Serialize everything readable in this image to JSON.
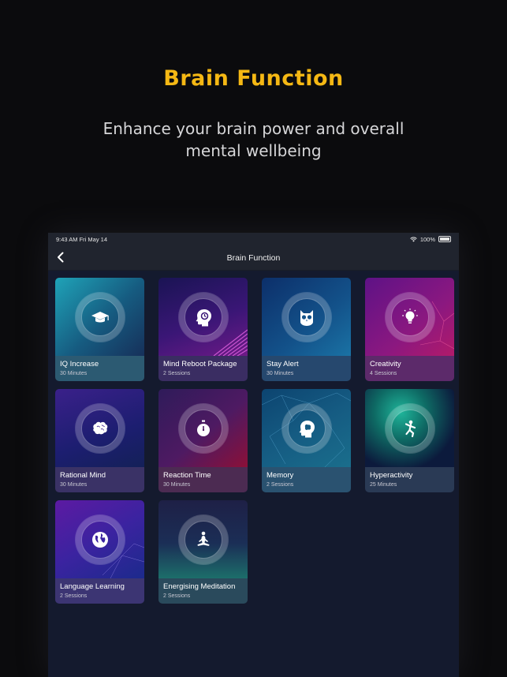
{
  "hero": {
    "title": "Brain Function",
    "subtitle": "Enhance your brain power and overall mental wellbeing"
  },
  "statusbar": {
    "time_date": "9:43 AM   Fri May 14",
    "battery": "100%"
  },
  "nav": {
    "title": "Brain Function",
    "back_icon": "chevron-left-icon"
  },
  "cards": [
    {
      "title": "IQ Increase",
      "subtitle": "30 Minutes",
      "icon": "graduation-cap-icon"
    },
    {
      "title": "Mind Reboot Package",
      "subtitle": "2 Sessions",
      "icon": "head-reboot-icon"
    },
    {
      "title": "Stay Alert",
      "subtitle": "30 Minutes",
      "icon": "owl-icon"
    },
    {
      "title": "Creativity",
      "subtitle": "4 Sessions",
      "icon": "lightbulb-icon"
    },
    {
      "title": "Rational Mind",
      "subtitle": "30 Minutes",
      "icon": "brain-icon"
    },
    {
      "title": "Reaction Time",
      "subtitle": "30 Minutes",
      "icon": "stopwatch-icon"
    },
    {
      "title": "Memory",
      "subtitle": "2 Sessions",
      "icon": "head-brain-icon"
    },
    {
      "title": "Hyperactivity",
      "subtitle": "25 Minutes",
      "icon": "dancing-figure-icon"
    },
    {
      "title": "Language Learning",
      "subtitle": "2 Sessions",
      "icon": "globe-icon"
    },
    {
      "title": "Energising Meditation",
      "subtitle": "2 Sessions",
      "icon": "meditation-icon"
    }
  ],
  "colors": {
    "accent": "#f5b814",
    "background": "#0b0b0d",
    "screen": "#141a2e"
  }
}
